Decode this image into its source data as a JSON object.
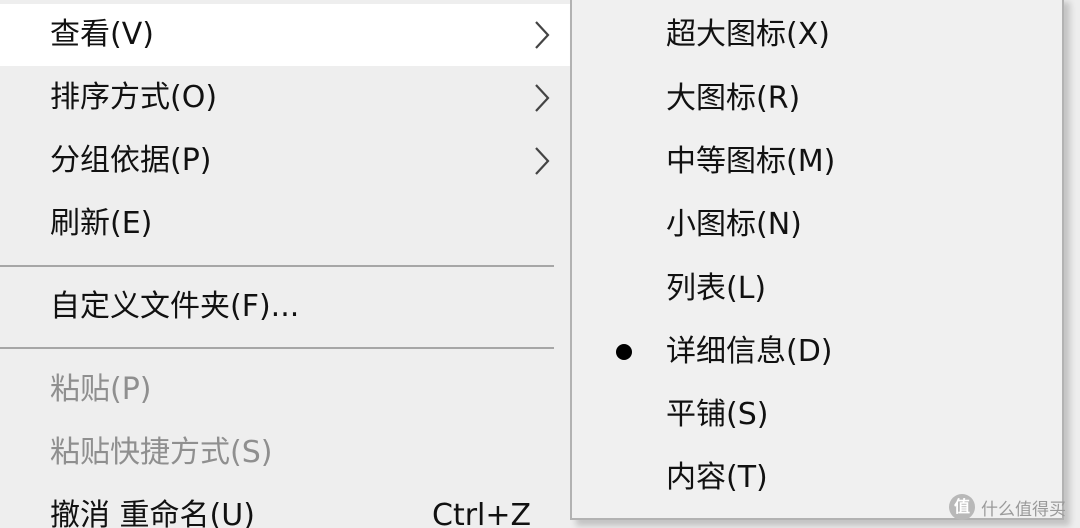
{
  "context_menu": {
    "items": [
      {
        "label": "查看(V)",
        "has_submenu": true,
        "highlighted": true
      },
      {
        "label": "排序方式(O)",
        "has_submenu": true
      },
      {
        "label": "分组依据(P)",
        "has_submenu": true
      },
      {
        "label": "刷新(E)"
      },
      {
        "label": "自定义文件夹(F)..."
      },
      {
        "label": "粘贴(P)",
        "disabled": true
      },
      {
        "label": "粘贴快捷方式(S)",
        "disabled": true
      },
      {
        "label": "撤消 重命名(U)",
        "shortcut": "Ctrl+Z"
      }
    ]
  },
  "view_submenu": {
    "items": [
      {
        "label": "超大图标(X)"
      },
      {
        "label": "大图标(R)"
      },
      {
        "label": "中等图标(M)"
      },
      {
        "label": "小图标(N)"
      },
      {
        "label": "列表(L)"
      },
      {
        "label": "详细信息(D)",
        "selected": true
      },
      {
        "label": "平铺(S)"
      },
      {
        "label": "内容(T)"
      }
    ]
  },
  "watermark": {
    "logo": "值",
    "text": "什么值得买"
  },
  "icons": {
    "submenu_arrow": "chevron-right-icon",
    "selected_marker": "radio-bullet-icon"
  },
  "colors": {
    "menu_background": "#eeeeee",
    "highlight": "#ffffff",
    "disabled_text": "#8f8f8f",
    "separator": "#a6a6a6"
  }
}
